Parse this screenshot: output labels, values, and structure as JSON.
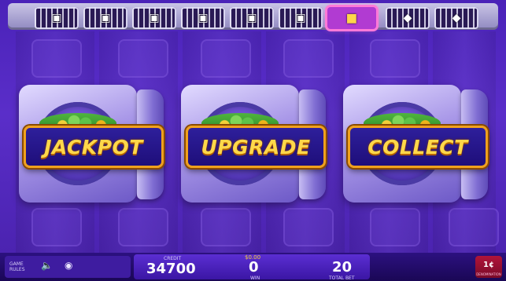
{
  "progress": {
    "slots": [
      {
        "icon": "vault-icon"
      },
      {
        "icon": "vault-icon"
      },
      {
        "icon": "vault-icon"
      },
      {
        "icon": "vault-icon"
      },
      {
        "icon": "vault-icon"
      },
      {
        "icon": "vault-icon"
      },
      {
        "icon": "treasure-chest-icon",
        "active": true
      },
      {
        "icon": "gift-box-icon"
      },
      {
        "icon": "gift-box-icon"
      }
    ]
  },
  "vaults": [
    {
      "label": "JACKPOT"
    },
    {
      "label": "UPGRADE"
    },
    {
      "label": "COLLECT"
    }
  ],
  "footer": {
    "game_rules": "GAME RULES",
    "credit_label": "CREDIT",
    "credit_value": "34700",
    "win_amount": "$0.00",
    "win_value": "0",
    "win_label": "WIN",
    "total_bet_value": "20",
    "total_bet_label": "TOTAL BET",
    "denom_value": "1¢",
    "denom_label": "DENOMINATION"
  },
  "colors": {
    "accent_gold": "#ffd84a",
    "button_border": "#f0a11d",
    "background_purple": "#4a22b8",
    "active_slot": "#ff7ad8",
    "denom_red": "#b0143a"
  }
}
